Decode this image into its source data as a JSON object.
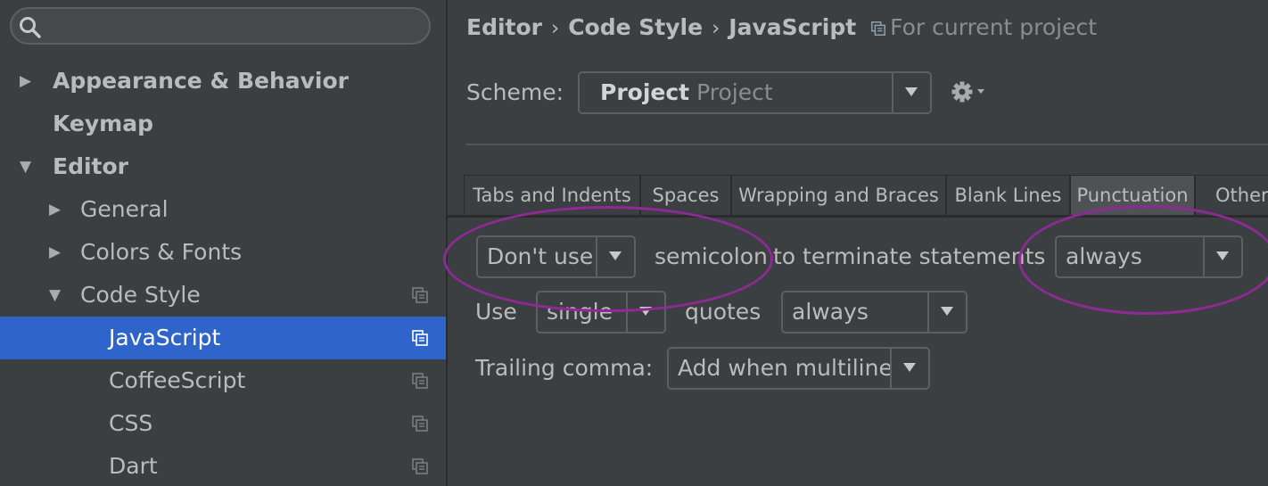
{
  "sidebar": {
    "search": {
      "placeholder": "",
      "value": ""
    },
    "items": [
      {
        "label": "Appearance & Behavior",
        "arrow": "▶",
        "bold": true,
        "indent": 0
      },
      {
        "label": "Keymap",
        "arrow": "",
        "bold": true,
        "indent": 0
      },
      {
        "label": "Editor",
        "arrow": "▼",
        "bold": true,
        "indent": 0
      },
      {
        "label": "General",
        "arrow": "▶",
        "bold": false,
        "indent": 1
      },
      {
        "label": "Colors & Fonts",
        "arrow": "▶",
        "bold": false,
        "indent": 1
      },
      {
        "label": "Code Style",
        "arrow": "▼",
        "bold": false,
        "indent": 1,
        "project_icon": true
      },
      {
        "label": "JavaScript",
        "arrow": "",
        "bold": false,
        "indent": 2,
        "project_icon": true,
        "selected": true
      },
      {
        "label": "CoffeeScript",
        "arrow": "",
        "bold": false,
        "indent": 2,
        "project_icon": true
      },
      {
        "label": "CSS",
        "arrow": "",
        "bold": false,
        "indent": 2,
        "project_icon": true
      },
      {
        "label": "Dart",
        "arrow": "",
        "bold": false,
        "indent": 2,
        "project_icon": true
      }
    ]
  },
  "breadcrumb": {
    "items": [
      "Editor",
      "Code Style",
      "JavaScript"
    ],
    "separator": "›",
    "scope": "For current project"
  },
  "scheme": {
    "label": "Scheme:",
    "value": "Project",
    "sub": "Project"
  },
  "tabs": [
    {
      "label": "Tabs and Indents"
    },
    {
      "label": "Spaces"
    },
    {
      "label": "Wrapping and Braces"
    },
    {
      "label": "Blank Lines"
    },
    {
      "label": "Punctuation",
      "active": true
    },
    {
      "label": "Other"
    }
  ],
  "punctuation": {
    "row1": {
      "select_value": "Don't use",
      "text1": "semicolon",
      "text2": "to terminate statements",
      "select2_value": "always"
    },
    "row2": {
      "prefix": "Use",
      "select_value": "single",
      "text": "quotes",
      "select2_value": "always"
    },
    "row3": {
      "label": "Trailing comma:",
      "select_value": "Add when multiline"
    }
  },
  "colors": {
    "background": "#3c3f41",
    "selection": "#2f65ca",
    "annotation": "#8e2a95"
  },
  "icons": [
    "search-icon",
    "expand-arrow-icon",
    "project-scope-icon",
    "chevron-down-icon",
    "gear-icon"
  ]
}
